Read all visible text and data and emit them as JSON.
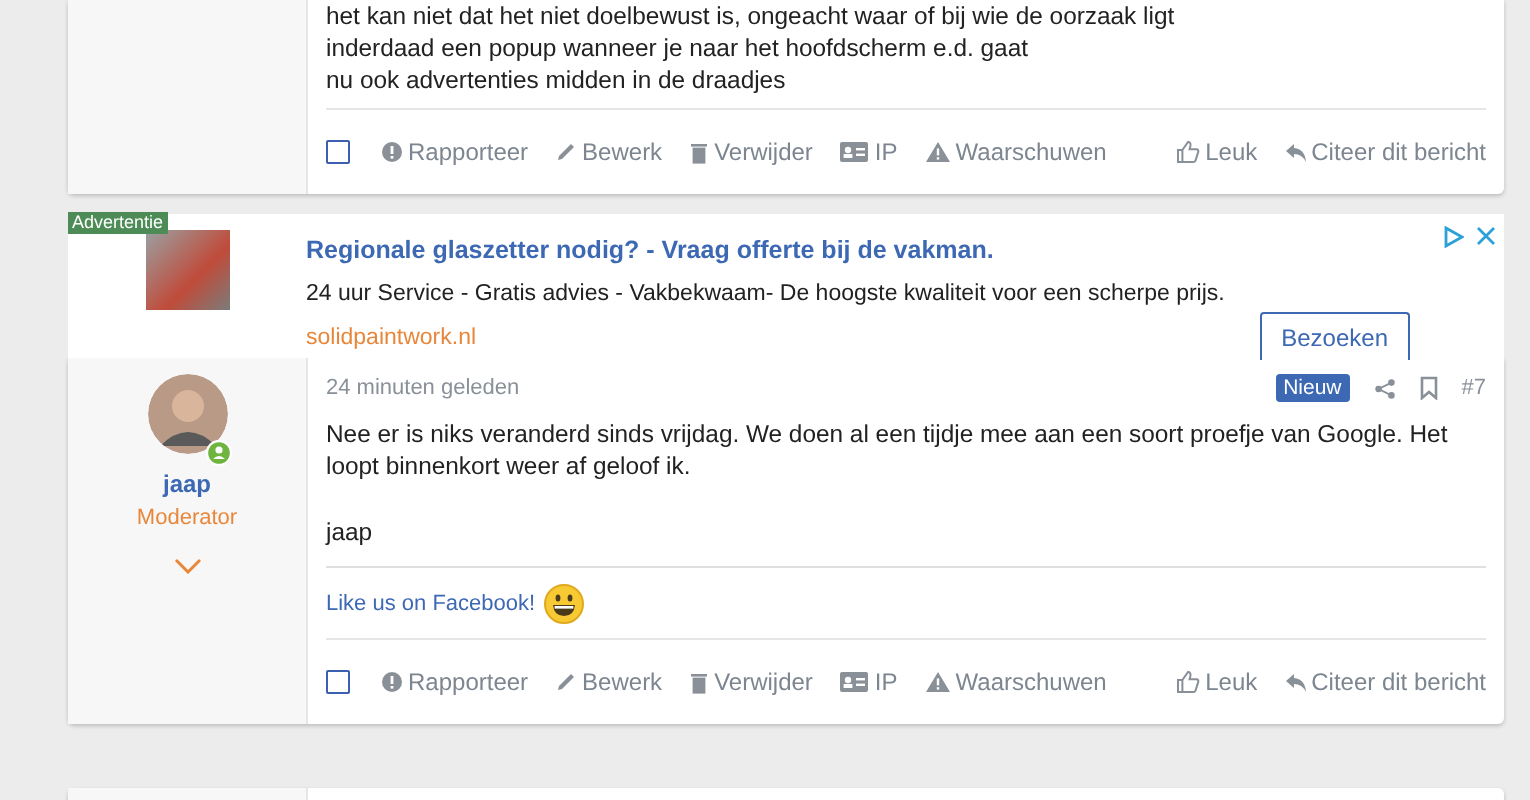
{
  "posts": [
    {
      "kind": "partial",
      "paragraphs": [
        [
          "het kan niet dat het niet doelbewust is, ongeacht waar of bij wie de oorzaak ligt",
          "inderdaad een popup wanneer je naar het hoofdscherm e.d. gaat",
          "nu ook advertenties midden in de draadjes"
        ]
      ],
      "selected": false,
      "actions": [
        {
          "kind": "report",
          "label": "Rapporteer"
        },
        {
          "kind": "edit",
          "label": "Bewerk"
        },
        {
          "kind": "delete",
          "label": "Verwijder"
        },
        {
          "kind": "ip",
          "label": "IP"
        },
        {
          "kind": "warn",
          "label": "Waarschuwen"
        }
      ],
      "reactions": [
        {
          "kind": "like",
          "label": "Leuk"
        },
        {
          "kind": "quote",
          "label": "Citeer dit bericht"
        }
      ]
    },
    {
      "kind": "ad",
      "label": "Advertentie",
      "title": "Regionale glaszetter nodig? - Vraag offerte bij de vakman.",
      "description": "24 uur Service - Gratis advies - Vakbekwaam- De hoogste kwaliteit voor een scherpe prijs.",
      "url": "solidpaintwork.nl",
      "button": "Bezoeken"
    },
    {
      "kind": "full",
      "user": {
        "name": "jaap",
        "role": "Moderator",
        "online": true
      },
      "time": "24 minuten geleden",
      "badge": "Nieuw",
      "number": "#7",
      "paragraphs": [
        [
          "Nee er is niks veranderd sinds vrijdag. We doen al een tijdje mee aan een soort proefje van Google. Het loopt binnenkort weer af geloof ik."
        ],
        [
          "jaap"
        ]
      ],
      "signature": "Like us on Facebook!",
      "selected": false,
      "actions": [
        {
          "kind": "report",
          "label": "Rapporteer"
        },
        {
          "kind": "edit",
          "label": "Bewerk"
        },
        {
          "kind": "delete",
          "label": "Verwijder"
        },
        {
          "kind": "ip",
          "label": "IP"
        },
        {
          "kind": "warn",
          "label": "Waarschuwen"
        }
      ],
      "reactions": [
        {
          "kind": "like",
          "label": "Leuk"
        },
        {
          "kind": "quote",
          "label": "Citeer dit bericht"
        }
      ]
    },
    {
      "kind": "stub"
    }
  ]
}
